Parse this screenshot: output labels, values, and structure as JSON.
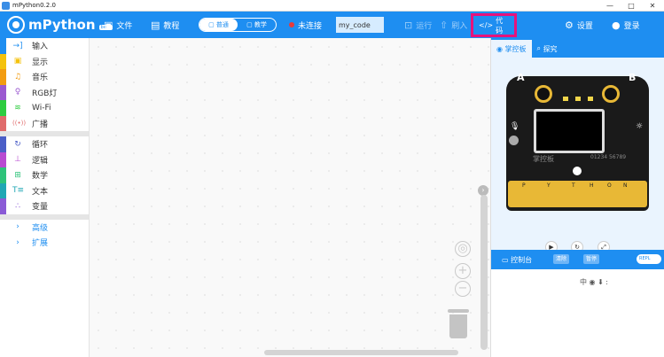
{
  "window": {
    "title": "mPython0.2.0",
    "controls": [
      "—",
      "□",
      "✕"
    ]
  },
  "toolbar": {
    "logo_text": "mPython",
    "logo_badge": "beta",
    "file_label": "文件",
    "tutorial_label": "教程",
    "mode_normal": "普通",
    "mode_teach": "教学",
    "connect_status": "未连接",
    "project_name": "my_code",
    "run_label": "运行",
    "flash_label": "刷入",
    "code_label": "代码",
    "settings_label": "设置",
    "login_label": "登录"
  },
  "categories": [
    {
      "label": "输入",
      "color": "#1e8ef1",
      "icon": "→]"
    },
    {
      "label": "显示",
      "color": "#f4c20d",
      "icon": "▣"
    },
    {
      "label": "音乐",
      "color": "#f29c11",
      "icon": "♫"
    },
    {
      "label": "RGB灯",
      "color": "#9b59d0",
      "icon": "♀"
    },
    {
      "label": "Wi-Fi",
      "color": "#2ecc40",
      "icon": "≋"
    },
    {
      "label": "广播",
      "color": "#e06b6b",
      "icon": "((•))"
    }
  ],
  "categories2": [
    {
      "label": "循环",
      "color": "#4b5ec7",
      "icon": "↻"
    },
    {
      "label": "逻辑",
      "color": "#b84bd1",
      "icon": "⊥"
    },
    {
      "label": "数学",
      "color": "#2ec37a",
      "icon": "⊞"
    },
    {
      "label": "文本",
      "color": "#20a7b4",
      "icon": "T≡"
    },
    {
      "label": "变量",
      "color": "#8a5bd6",
      "icon": "∴"
    }
  ],
  "categories_adv": [
    {
      "label": "高级",
      "icon": "›"
    },
    {
      "label": "扩展",
      "icon": "›"
    }
  ],
  "right_panel": {
    "tab_board": "掌控板",
    "tab_explore": "探究",
    "board_label_a": "A",
    "board_label_b": "B",
    "board_brand": "掌控板",
    "board_qr_text": "01234\n56789",
    "pins": [
      "P",
      "Y",
      "T",
      "H",
      "O",
      "N"
    ],
    "console_label": "控制台",
    "console_btn1": "清除",
    "console_btn2": "暂停",
    "console_toggle": "REPL",
    "ime_text": "中 ◉ ⬇ :"
  }
}
